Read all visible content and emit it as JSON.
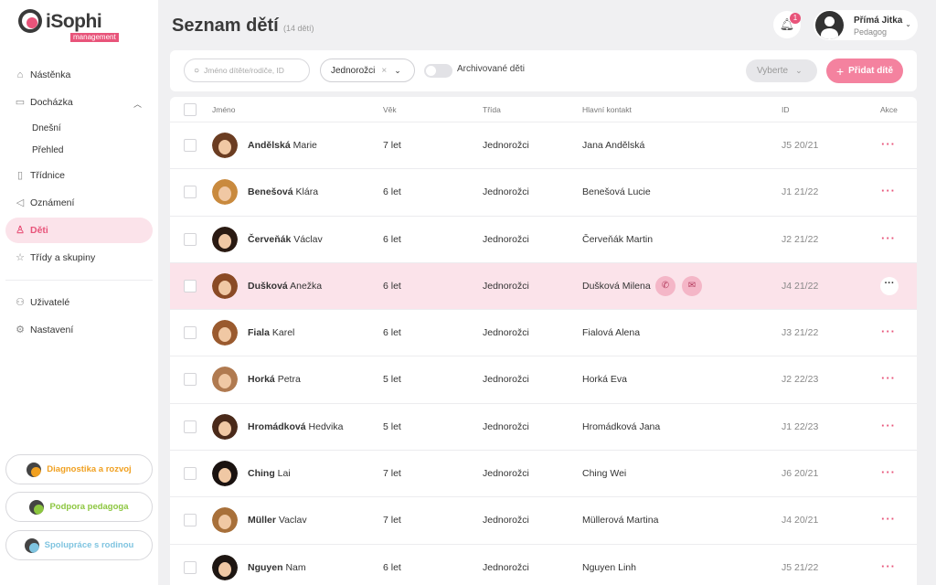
{
  "app": {
    "name": "iSophi",
    "sub": "management"
  },
  "sidebar": {
    "items": [
      {
        "label": "Nástěnka",
        "icon": "home-icon"
      },
      {
        "label": "Docházka",
        "icon": "calendar-icon"
      },
      {
        "label": "Třídnice",
        "icon": "book-icon"
      },
      {
        "label": "Oznámení",
        "icon": "megaphone-icon"
      },
      {
        "label": "Děti",
        "icon": "person-icon"
      },
      {
        "label": "Třídy a skupiny",
        "icon": "star-icon"
      },
      {
        "label": "Uživatelé",
        "icon": "users-icon"
      },
      {
        "label": "Nastavení",
        "icon": "gear-icon"
      }
    ],
    "sub_items": [
      "Dnešní",
      "Přehled"
    ],
    "bottom_buttons": [
      {
        "label": "Diagnostika a rozvoj",
        "color": "#f0a020"
      },
      {
        "label": "Podpora pedagoga",
        "color": "#8cc63f"
      },
      {
        "label": "Spolupráce s rodinou",
        "color": "#7fc4e0"
      }
    ]
  },
  "header": {
    "title": "Seznam dětí",
    "count": "(14 dětí)",
    "notifications": "1",
    "user_name": "Přímá Jitka",
    "user_role": "Pedagog"
  },
  "toolbar": {
    "search_placeholder": "Jméno dítěte/rodiče, ID",
    "filter_value": "Jednorožci",
    "archived_label": "Archivované děti",
    "select_label": "Vyberte",
    "add_label": "Přidat dítě"
  },
  "table": {
    "columns": [
      "Jméno",
      "Věk",
      "Třída",
      "Hlavní kontakt",
      "ID",
      "Akce"
    ],
    "rows": [
      {
        "surname": "Andělská",
        "first": "Marie",
        "age": "7 let",
        "class": "Jednorožci",
        "contact": "Jana Andělská",
        "id": "J5 20/21",
        "hair": "#6b3d22"
      },
      {
        "surname": "Benešová",
        "first": "Klára",
        "age": "6 let",
        "class": "Jednorožci",
        "contact": "Benešová Lucie",
        "id": "J1 21/22",
        "hair": "#c98a3e"
      },
      {
        "surname": "Červeňák",
        "first": "Václav",
        "age": "6 let",
        "class": "Jednorožci",
        "contact": "Červeňák Martin",
        "id": "J2 21/22",
        "hair": "#2a1a12"
      },
      {
        "surname": "Dušková",
        "first": "Anežka",
        "age": "6 let",
        "class": "Jednorožci",
        "contact": "Dušková Milena",
        "id": "J4 21/22",
        "hair": "#8a4a25"
      },
      {
        "surname": "Fiala",
        "first": "Karel",
        "age": "6 let",
        "class": "Jednorožci",
        "contact": "Fialová Alena",
        "id": "J3 21/22",
        "hair": "#9a5a2e"
      },
      {
        "surname": "Horká",
        "first": "Petra",
        "age": "5 let",
        "class": "Jednorožci",
        "contact": "Horká Eva",
        "id": "J2 22/23",
        "hair": "#b07a50"
      },
      {
        "surname": "Hromádková",
        "first": "Hedvika",
        "age": "5 let",
        "class": "Jednorožci",
        "contact": "Hromádková Jana",
        "id": "J1 22/23",
        "hair": "#4a2a1a"
      },
      {
        "surname": "Ching",
        "first": "Lai",
        "age": "7 let",
        "class": "Jednorožci",
        "contact": "Ching Wei",
        "id": "J6 20/21",
        "hair": "#1a1210"
      },
      {
        "surname": "Müller",
        "first": "Vaclav",
        "age": "7 let",
        "class": "Jednorožci",
        "contact": "Müllerová Martina",
        "id": "J4 20/21",
        "hair": "#a8703a"
      },
      {
        "surname": "Nguyen",
        "first": "Nam",
        "age": "6 let",
        "class": "Jednorožci",
        "contact": "Nguyen Linh",
        "id": "J5 21/22",
        "hair": "#1e1612"
      }
    ],
    "highlighted_row": 3
  }
}
